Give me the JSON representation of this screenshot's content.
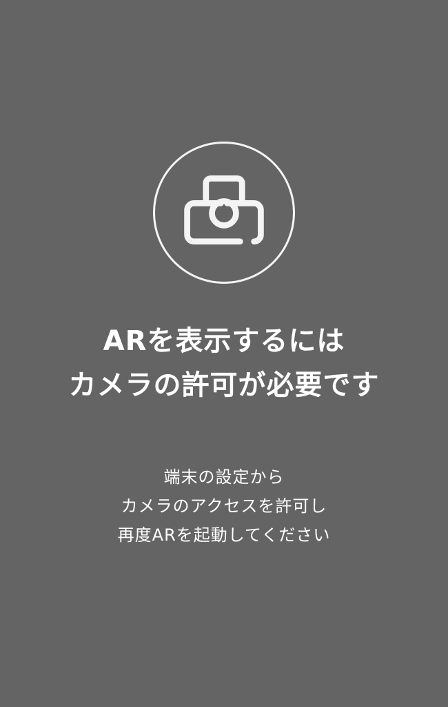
{
  "permission_screen": {
    "icon": "camera-icon",
    "colors": {
      "background": "#646464",
      "foreground": "#ffffff",
      "icon_stroke": "#f4f4f4"
    },
    "heading_lines": [
      "ARを表示するには",
      "カメラの許可が必要です"
    ],
    "instruction_lines": [
      "端末の設定から",
      "カメラのアクセスを許可し",
      "再度ARを起動してください"
    ]
  }
}
